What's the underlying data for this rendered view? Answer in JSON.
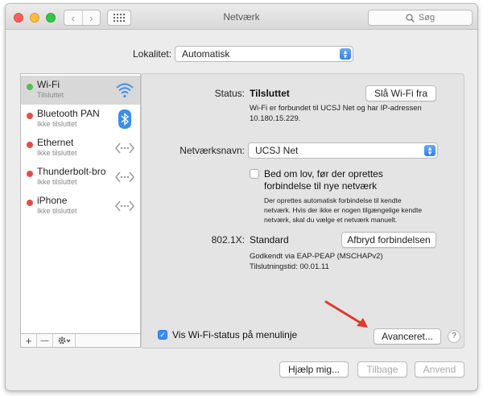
{
  "window": {
    "title": "Netværk",
    "search_placeholder": "Søg",
    "back_icon": "chevron-left-icon",
    "forward_icon": "chevron-right-icon"
  },
  "location": {
    "label": "Lokalitet:",
    "value": "Automatisk"
  },
  "services": [
    {
      "name": "Wi-Fi",
      "status": "Tilsluttet",
      "status_color": "#4cc24a",
      "icon": "wifi-icon",
      "selected": true
    },
    {
      "name": "Bluetooth PAN",
      "status": "Ikke tilsluttet",
      "status_color": "#ea4b43",
      "icon": "bluetooth-icon"
    },
    {
      "name": "Ethernet",
      "status": "Ikke tilsluttet",
      "status_color": "#ea4b43",
      "icon": "ethernet-icon"
    },
    {
      "name": "Thunderbolt-bro",
      "status": "Ikke tilsluttet",
      "status_color": "#ea4b43",
      "icon": "thunderbolt-bridge-icon"
    },
    {
      "name": "iPhone",
      "status": "Ikke tilsluttet",
      "status_color": "#ea4b43",
      "icon": "iphone-icon"
    }
  ],
  "sidebar_actions": {
    "add": "+",
    "remove": "—",
    "gear_icon": "gear-icon"
  },
  "detail": {
    "status_label": "Status:",
    "status_value": "Tilsluttet",
    "wifi_off_button": "Slå Wi-Fi fra",
    "status_desc_1": "Wi-Fi er forbundet til UCSJ Net og har IP-adressen",
    "status_desc_2": "10.180.15.229.",
    "network_name_label": "Netværksnavn:",
    "network_name_value": "UCSJ Net",
    "ask_join_line1": "Bed om lov, før der oprettes",
    "ask_join_line2": "forbindelse til nye netværk",
    "ask_join_checked": false,
    "ask_desc_1": "Der oprettes automatisk forbindelse til kendte",
    "ask_desc_2": "netværk. Hvis der ikke er nogen tilgængelige kendte",
    "ask_desc_3": "netværk, skal du vælge et netværk manuelt.",
    "dot1x_label": "802.1X:",
    "dot1x_value": "Standard",
    "disconnect_button": "Afbryd forbindelsen",
    "auth_line": "Godkendt via EAP-PEAP (MSCHAPv2)",
    "conn_time": "Tilslutningstid: 00.01.11",
    "show_status_label": "Vis Wi-Fi-status på menulinje",
    "show_status_checked": true,
    "advanced_button": "Avanceret...",
    "help_button": "?"
  },
  "footer": {
    "assist_button": "Hjælp mig...",
    "revert_button": "Tilbage",
    "apply_button": "Anvend"
  },
  "colors": {
    "accent": "#2f80ed",
    "annotation_arrow": "#e0392b"
  }
}
